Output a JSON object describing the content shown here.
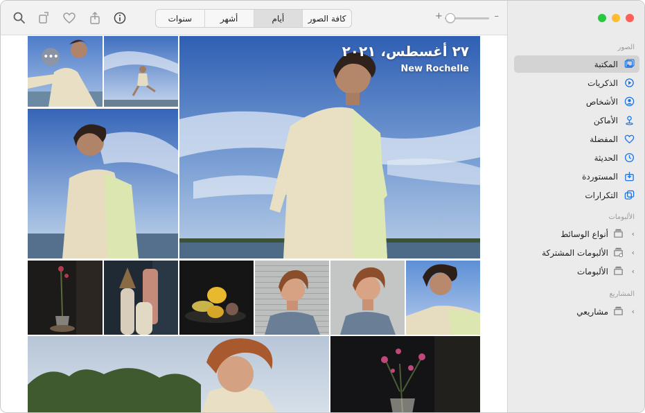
{
  "toolbar": {
    "segments": [
      {
        "label": "سنوات",
        "active": false
      },
      {
        "label": "أشهر",
        "active": false
      },
      {
        "label": "أيام",
        "active": true
      },
      {
        "label": "كافة الصور",
        "active": false
      }
    ],
    "zoom_plus": "+",
    "zoom_minus": "–",
    "icons": [
      "search-icon",
      "rotate-icon",
      "heart-icon",
      "share-icon",
      "info-icon"
    ]
  },
  "sidebar": {
    "traffic_colors": {
      "close": "#ff5f57",
      "minimize": "#febc2e",
      "zoom": "#28c840"
    },
    "section_photos": "الصور",
    "photos_items": [
      {
        "label": "المكتبة",
        "icon": "library-icon",
        "selected": true
      },
      {
        "label": "الذكريات",
        "icon": "memories-icon",
        "selected": false
      },
      {
        "label": "الأشخاص",
        "icon": "people-icon",
        "selected": false
      },
      {
        "label": "الأماكن",
        "icon": "places-icon",
        "selected": false
      },
      {
        "label": "المفضلة",
        "icon": "heart-icon",
        "selected": false
      },
      {
        "label": "الحديثة",
        "icon": "clock-icon",
        "selected": false
      },
      {
        "label": "المستوردة",
        "icon": "import-icon",
        "selected": false
      },
      {
        "label": "التكرارات",
        "icon": "duplicates-icon",
        "selected": false
      }
    ],
    "section_albums": "الألبومات",
    "albums_items": [
      {
        "label": "أنواع الوسائط"
      },
      {
        "label": "الألبومات المشتركة"
      },
      {
        "label": "الألبومات"
      }
    ],
    "section_projects": "المشاريع",
    "projects_items": [
      {
        "label": "مشاريعي"
      }
    ]
  },
  "grid": {
    "hero_date": "٢٧ أغسطس، ٢٠٢١",
    "hero_place": "New Rochelle",
    "more_label": "•••"
  },
  "colors": {
    "accent": "#1a73e8",
    "sidebar_bg": "#ebebeb",
    "selected_bg": "#d3d3d3"
  }
}
